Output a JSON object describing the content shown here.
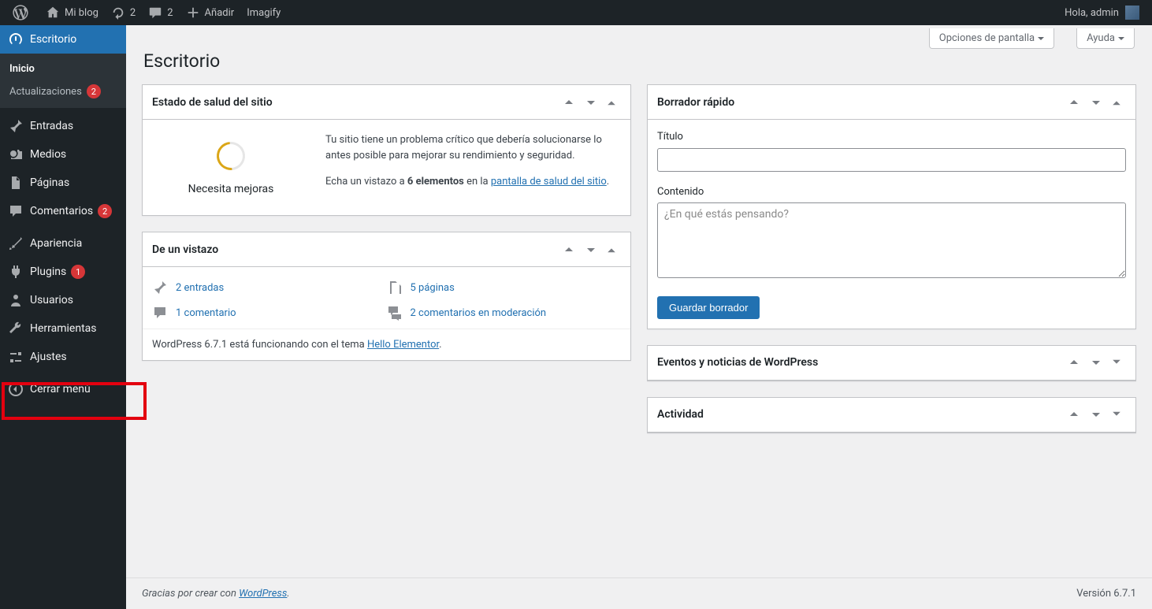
{
  "adminbar": {
    "site_name": "Mi blog",
    "updates": "2",
    "comments": "2",
    "add_new": "Añadir",
    "imagify": "Imagify",
    "greeting": "Hola, admin"
  },
  "sidebar": {
    "dashboard": "Escritorio",
    "submenu": {
      "home": "Inicio",
      "updates": "Actualizaciones",
      "updates_badge": "2"
    },
    "posts": "Entradas",
    "media": "Medios",
    "pages": "Páginas",
    "comments": "Comentarios",
    "comments_badge": "2",
    "appearance": "Apariencia",
    "plugins": "Plugins",
    "plugins_badge": "1",
    "users": "Usuarios",
    "tools": "Herramientas",
    "settings": "Ajustes",
    "collapse": "Cerrar menú"
  },
  "screen_meta": {
    "options": "Opciones de pantalla",
    "help": "Ayuda"
  },
  "page_title": "Escritorio",
  "health": {
    "title": "Estado de salud del sitio",
    "gauge_label": "Necesita mejoras",
    "p1": "Tu sitio tiene un problema crítico que debería solucionarse lo antes posible para mejorar su rendimiento y seguridad.",
    "p2a": "Echa un vistazo a ",
    "p2b": "6 elementos",
    "p2c": " en la ",
    "p2link": "pantalla de salud del sitio",
    "p2d": "."
  },
  "glance": {
    "title": "De un vistazo",
    "posts": "2 entradas",
    "pages": "5 páginas",
    "comment": "1 comentario",
    "pending": "2 comentarios en moderación",
    "foot_a": "WordPress 6.7.1 está funcionando con el tema ",
    "foot_link": "Hello Elementor",
    "foot_b": "."
  },
  "quickdraft": {
    "title": "Borrador rápido",
    "label_title": "Título",
    "label_content": "Contenido",
    "placeholder": "¿En qué estás pensando?",
    "save": "Guardar borrador"
  },
  "events": {
    "title": "Eventos y noticias de WordPress"
  },
  "activity": {
    "title": "Actividad"
  },
  "footer": {
    "thanks_a": "Gracias por crear con ",
    "thanks_link": "WordPress",
    "thanks_b": ".",
    "version": "Versión 6.7.1"
  }
}
